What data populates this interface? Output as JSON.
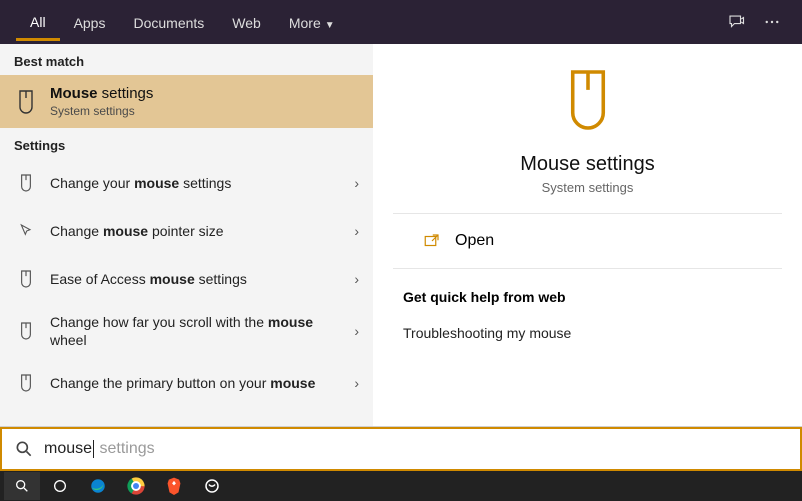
{
  "tabs": {
    "all": "All",
    "apps": "Apps",
    "documents": "Documents",
    "web": "Web",
    "more": "More"
  },
  "left": {
    "best_match_label": "Best match",
    "best_match": {
      "title_bold": "Mouse",
      "title_rest": " settings",
      "subtitle": "System settings"
    },
    "settings_label": "Settings",
    "items": [
      {
        "pre": "Change your ",
        "bold": "mouse",
        "post": " settings"
      },
      {
        "pre": "Change ",
        "bold": "mouse",
        "post": " pointer size"
      },
      {
        "pre": "Ease of Access ",
        "bold": "mouse",
        "post": " settings"
      },
      {
        "pre": "Change how far you scroll with the ",
        "bold": "mouse",
        "post": " wheel"
      },
      {
        "pre": "Change the primary button on your ",
        "bold": "mouse",
        "post": ""
      }
    ]
  },
  "right": {
    "title": "Mouse settings",
    "subtitle": "System settings",
    "open": "Open",
    "help_header": "Get quick help from web",
    "help_link": "Troubleshooting my mouse"
  },
  "search": {
    "typed": "mouse",
    "suggestion": " settings"
  },
  "colors": {
    "accent": "#d08a00"
  }
}
